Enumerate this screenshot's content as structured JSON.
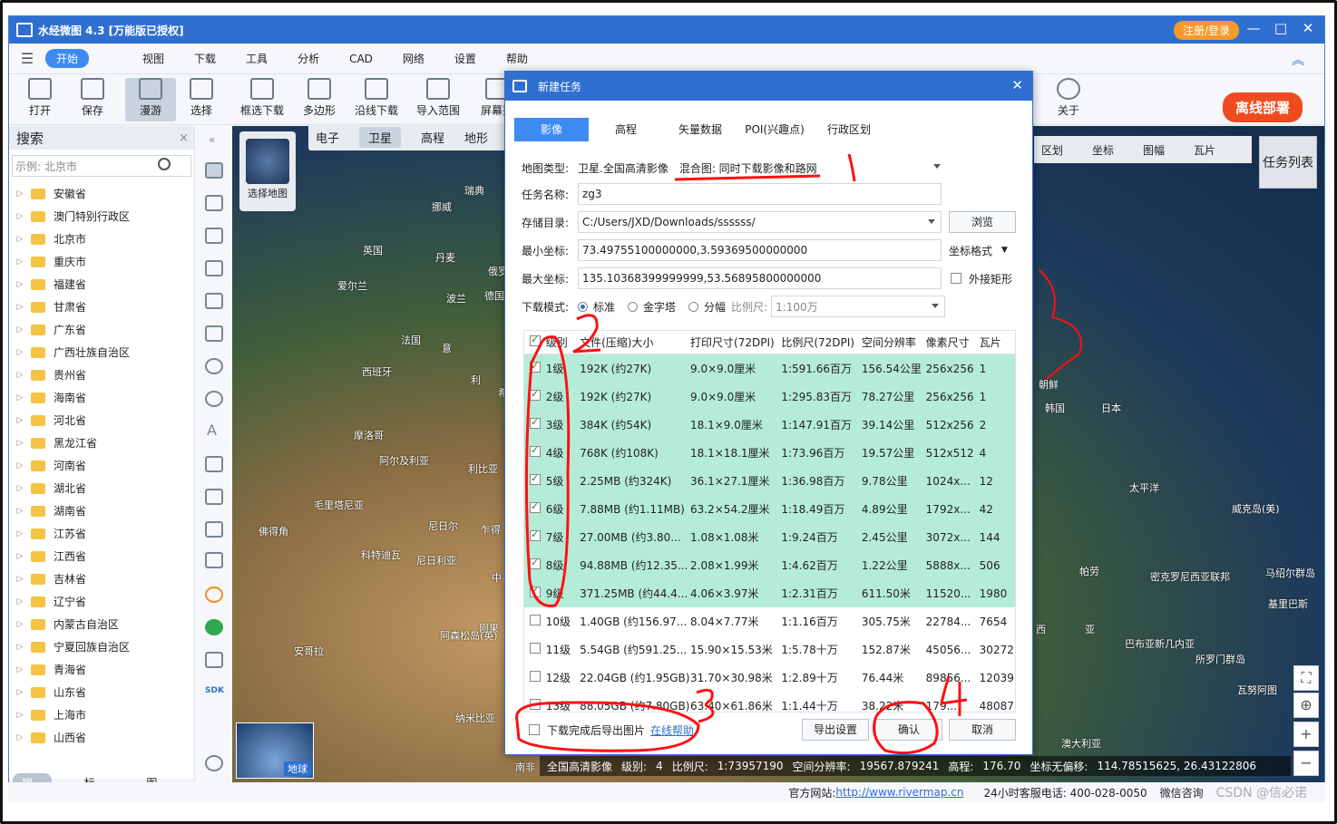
{
  "app": {
    "title": "水经微图 4.3 [万能版已授权]",
    "register_label": "注册/登录",
    "minimize": "—",
    "maximize": "□",
    "close": "✕"
  },
  "menu": {
    "items": [
      "开始",
      "视图",
      "下载",
      "工具",
      "分析",
      "CAD",
      "网络",
      "设置",
      "帮助"
    ]
  },
  "toolbar": {
    "items": [
      {
        "label": "打开",
        "icon": "folder-open-icon"
      },
      {
        "label": "保存",
        "icon": "save-icon"
      },
      {
        "label": "漫游",
        "icon": "hand-icon"
      },
      {
        "label": "选择",
        "icon": "cursor-icon"
      },
      {
        "label": "框选下载",
        "icon": "box-download-icon"
      },
      {
        "label": "多边形",
        "icon": "polygon-icon"
      },
      {
        "label": "沿线下载",
        "icon": "line-download-icon"
      },
      {
        "label": "导入范围",
        "icon": "import-range-icon"
      },
      {
        "label": "屏幕范",
        "icon": "screen-range-icon"
      },
      {
        "label": "关于",
        "icon": "info-icon"
      }
    ],
    "deploy_label": "离线部署"
  },
  "sidebar": {
    "title": "搜索",
    "close": "×",
    "search_placeholder": "示例: 北京市",
    "items": [
      "安徽省",
      "澳门特别行政区",
      "北京市",
      "重庆市",
      "福建省",
      "甘肃省",
      "广东省",
      "广西壮族自治区",
      "贵州省",
      "海南省",
      "河北省",
      "黑龙江省",
      "河南省",
      "湖北省",
      "湖南省",
      "江苏省",
      "江西省",
      "吉林省",
      "辽宁省",
      "内蒙古自治区",
      "宁夏回族自治区",
      "青海省",
      "山东省",
      "上海市",
      "山西省"
    ],
    "footer_tabs": [
      "搜索",
      "标注",
      "图层"
    ]
  },
  "map": {
    "tabs": [
      "电子",
      "卫星",
      "高程",
      "地形"
    ],
    "right_tabs": [
      "区划",
      "坐标",
      "图幅",
      "瓦片"
    ],
    "task_list": "任务列表",
    "select_map": "选择地图",
    "earth_label": "地球",
    "labels": [
      "瑞典",
      "挪威",
      "英国",
      "丹麦",
      "爱尔兰",
      "俄罗",
      "波兰",
      "德国",
      "法国",
      "意",
      "西班牙",
      "利",
      "希",
      "摩洛哥",
      "阿尔及利亚",
      "利比亚",
      "毛里塔尼亚",
      "佛得角",
      "尼日尔",
      "乍得",
      "尼日利亚",
      "科特迪瓦",
      "中",
      "刚果",
      "安哥拉",
      "阿森松岛(英)",
      "纳米比亚",
      "南非",
      "朝鲜",
      "韩国",
      "日本",
      "太平洋",
      "威克岛(美)",
      "帕劳",
      "密克罗尼西亚联邦",
      "马绍尔群岛",
      "基里巴斯",
      "巴布亚新几内亚",
      "所罗门群岛",
      "瓦努阿图",
      "澳大利亚",
      "西",
      "亚"
    ]
  },
  "status": {
    "layer": "全国高清影像",
    "level_label": "级别:",
    "level": "4",
    "scale_label": "比例尺:",
    "scale": "1:73957190",
    "res_label": "空间分辨率:",
    "res": "19567.879241",
    "elev_label": "高程:",
    "elev": "176.70",
    "coord_label": "坐标无偏移:",
    "coord": "114.78515625, 26.43122806"
  },
  "bottom": {
    "site_label": "官方网站:",
    "site_url": "http://www.rivermap.cn",
    "hotline": "24小时客服电话: 400-028-0050",
    "chat": "微信咨询",
    "watermark": "CSDN @信必诺"
  },
  "dialog": {
    "title": "新建任务",
    "close": "✕",
    "tabs": [
      "影像",
      "高程",
      "矢量数据",
      "POI(兴趣点)",
      "行政区划"
    ],
    "map_type_label": "地图类型:",
    "map_type_value": "卫星.全国高清影像",
    "map_type_mode": "混合图: 同时下载影像和路网",
    "task_name_label": "任务名称:",
    "task_name": "zg3",
    "dir_label": "存储目录:",
    "dir": "C:/Users/JXD/Downloads/ssssss/",
    "browse": "浏览",
    "min_label": "最小坐标:",
    "min_coord": "73.49755100000000,3.59369500000000",
    "coord_format": "坐标格式",
    "max_label": "最大坐标:",
    "max_coord": "135.10368399999999,53.56895800000000",
    "outer_rect": "外接矩形",
    "mode_label": "下载模式:",
    "modes": [
      "标准",
      "金字塔",
      "分幅"
    ],
    "scale_label": "比例尺:",
    "scale_value": "1:100万",
    "columns": [
      "级别",
      "文件(压缩)大小",
      "打印尺寸(72DPI)",
      "比例尺(72DPI)",
      "空间分辨率",
      "像素尺寸",
      "瓦片"
    ],
    "rows": [
      {
        "level": "1级",
        "size": "192K (约27K)",
        "print": "9.0×9.0厘米",
        "scale": "1:591.66百万",
        "res": "156.54公里",
        "px": "256x256",
        "tiles": "1",
        "checked": true
      },
      {
        "level": "2级",
        "size": "192K (约27K)",
        "print": "9.0×9.0厘米",
        "scale": "1:295.83百万",
        "res": "78.27公里",
        "px": "256x256",
        "tiles": "1",
        "checked": true
      },
      {
        "level": "3级",
        "size": "384K (约54K)",
        "print": "18.1×9.0厘米",
        "scale": "1:147.91百万",
        "res": "39.14公里",
        "px": "512x256",
        "tiles": "2",
        "checked": true
      },
      {
        "level": "4级",
        "size": "768K (约108K)",
        "print": "18.1×18.1厘米",
        "scale": "1:73.96百万",
        "res": "19.57公里",
        "px": "512x512",
        "tiles": "4",
        "checked": true
      },
      {
        "level": "5级",
        "size": "2.25MB (约324K)",
        "print": "36.1×27.1厘米",
        "scale": "1:36.98百万",
        "res": "9.78公里",
        "px": "1024x...",
        "tiles": "12",
        "checked": true
      },
      {
        "level": "6级",
        "size": "7.88MB (约1.11MB)",
        "print": "63.2×54.2厘米",
        "scale": "1:18.49百万",
        "res": "4.89公里",
        "px": "1792x...",
        "tiles": "42",
        "checked": true
      },
      {
        "level": "7级",
        "size": "27.00MB (约3.80...",
        "print": "1.08×1.08米",
        "scale": "1:9.24百万",
        "res": "2.45公里",
        "px": "3072x...",
        "tiles": "144",
        "checked": true
      },
      {
        "level": "8级",
        "size": "94.88MB (约12.35...",
        "print": "2.08×1.99米",
        "scale": "1:4.62百万",
        "res": "1.22公里",
        "px": "5888x...",
        "tiles": "506",
        "checked": true
      },
      {
        "level": "9级",
        "size": "371.25MB (约44.4...",
        "print": "4.06×3.97米",
        "scale": "1:2.31百万",
        "res": "611.50米",
        "px": "11520...",
        "tiles": "1980",
        "checked": true
      },
      {
        "level": "10级",
        "size": "1.40GB (约156.97...",
        "print": "8.04×7.77米",
        "scale": "1:1.16百万",
        "res": "305.75米",
        "px": "22784...",
        "tiles": "7654",
        "checked": false
      },
      {
        "level": "11级",
        "size": "5.54GB (约591.25...",
        "print": "15.90×15.53米",
        "scale": "1:5.78十万",
        "res": "152.87米",
        "px": "45056...",
        "tiles": "30272",
        "checked": false
      },
      {
        "level": "12级",
        "size": "22.04GB (约1.95GB)",
        "print": "31.70×30.98米",
        "scale": "1:2.89十万",
        "res": "76.44米",
        "px": "89856...",
        "tiles": "12039",
        "checked": false
      },
      {
        "level": "13级",
        "size": "88.05GB (约7.80GB)",
        "print": "63.40×61.86米",
        "scale": "1:1.44十万",
        "res": "38.22米",
        "px": "179...",
        "tiles": "48087",
        "checked": false
      }
    ],
    "export_after": "下载完成后导出图片",
    "help_link": "在线帮助",
    "export_settings": "导出设置",
    "confirm": "确认",
    "cancel": "取消"
  },
  "annotations": {
    "marks": [
      "1",
      "2",
      "3",
      "4"
    ],
    "color": "#ff1010"
  }
}
